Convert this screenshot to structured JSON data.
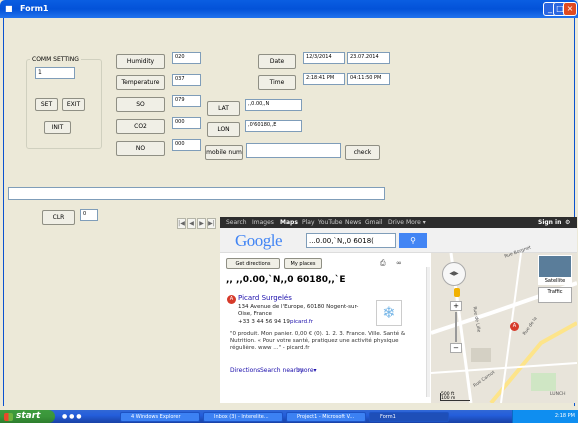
{
  "window": {
    "title": "Form1"
  },
  "comm": {
    "group_label": "COMM SETTING",
    "port_value": "1",
    "set_label": "SET",
    "exit_label": "EXIT",
    "init_label": "INIT"
  },
  "sensors": {
    "humidity_label": "Humidity",
    "humidity_value": "020",
    "temperature_label": "Temperature",
    "temperature_value": "037",
    "so_label": "SO",
    "so_value": "079",
    "co2_label": "CO2",
    "co2_value": "000",
    "no_label": "NO",
    "no_value": "000"
  },
  "position": {
    "lat_label": "LAT",
    "lat_value": ",,0.00,,N",
    "lon_label": "LON",
    "lon_value": ",0'60180,,E"
  },
  "datetime": {
    "date_label": "Date",
    "date_value1": "12/3/2014",
    "date_value2": "23.07.2014",
    "time_label": "Time",
    "time_value1": "2:18:41 PM",
    "time_value2": "04:11:50 PM"
  },
  "mobile": {
    "label": "mobile num",
    "value": "",
    "check_label": "check"
  },
  "bottom": {
    "clr_label": "CLR",
    "clr_value": "0"
  },
  "browser": {
    "nav_items": [
      "Search",
      "Images",
      "Maps",
      "Play",
      "YouTube",
      "News",
      "Gmail",
      "Drive",
      "More ▾"
    ],
    "sign_in": "Sign in",
    "google_logo": "Google",
    "search_text": "...0.00,`N,,0 6018(",
    "get_directions": "Get directions",
    "my_places": "My places",
    "result_heading": ",, ,,0.00,`N,,0 60180,,`E",
    "place_name": "Picard Surgelés",
    "place_address": "134 Avenue de l'Europe, 60180 Nogent-sur-Oise, France",
    "place_phone": "+33 3 44 56 94 19",
    "place_site": "picard.fr",
    "place_review": "\"0 produit. Mon panier. 0,00 € (0). 1. 2. 3. France. Ville. Santé & Nutrition. « Pour votre santé, pratiquez une activité physique régulière. www ...\" - picard.fr",
    "directions_link": "Directions",
    "search_nearby_link": "Search nearby",
    "more_link": "more▾",
    "map_satellite": "Satellite",
    "map_traffic": "Traffic",
    "map_scale_ft": "500 ft",
    "map_scale_m": "100 m",
    "map_road1": "Rue Borgnet",
    "map_road2": "Rue de Lille",
    "map_road3": "Rue Carnot",
    "map_road4": "Rue de la",
    "map_place": "LUNCH"
  },
  "taskbar": {
    "start_label": "start",
    "tasks": [
      "4 Windows Explorer",
      "Inbox (3) - Interelite...",
      "Project1 - Microsoft V...",
      "Form1"
    ],
    "clock": "2:18 PM"
  },
  "colors": {
    "xp_blue": "#0a5ee2",
    "start_green": "#3a953a",
    "google_blue": "#4285f4",
    "pin_red": "#d63a2a"
  }
}
